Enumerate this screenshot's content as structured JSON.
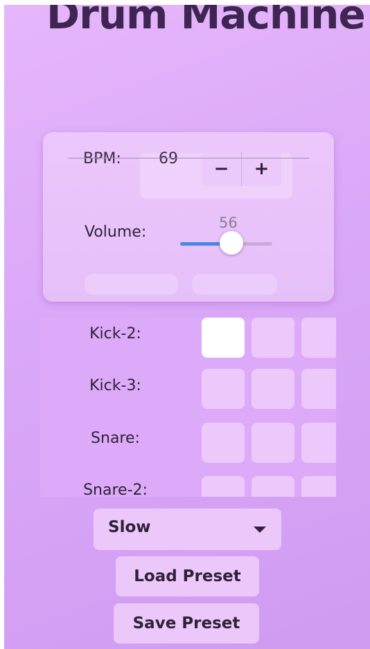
{
  "app": {
    "title": "Drum Machine"
  },
  "controls": {
    "bpm_label": "BPM:",
    "bpm_value": "69",
    "bpm_decrease": "−",
    "bpm_increase": "+",
    "volume_label": "Volume:",
    "volume_value": "56",
    "volume_fraction": 0.56
  },
  "tracks": [
    {
      "label": "Kick-2:",
      "steps": [
        true,
        false,
        false
      ]
    },
    {
      "label": "Kick-3:",
      "steps": [
        false,
        false,
        false
      ]
    },
    {
      "label": "Snare:",
      "steps": [
        false,
        false,
        false
      ]
    },
    {
      "label": "Snare-2:",
      "steps": [
        false,
        false,
        false
      ]
    }
  ],
  "preset": {
    "selected": "Slow",
    "load_label": "Load Preset",
    "save_label": "Save Preset"
  },
  "colors": {
    "background": "#dba9f8",
    "accent": "#4a86e6",
    "text": "#3f2552",
    "active_step": "#ffffff"
  }
}
